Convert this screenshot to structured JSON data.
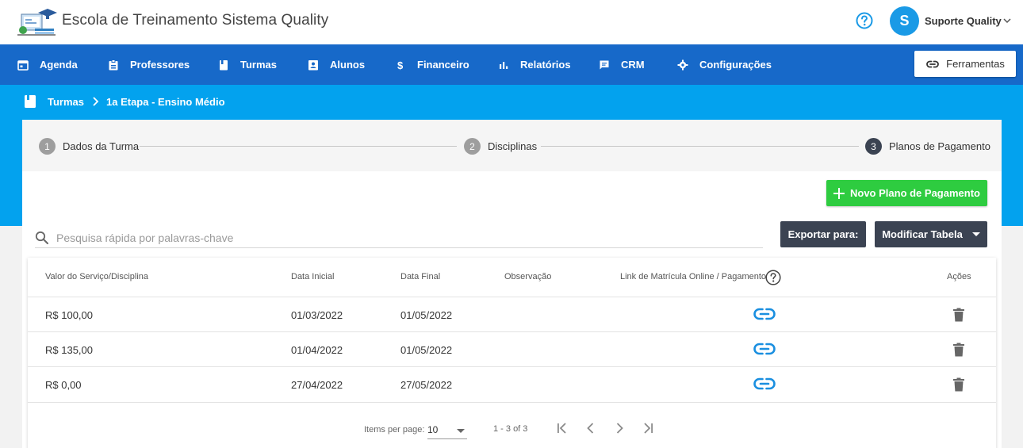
{
  "header": {
    "app_title": "Escola de Treinamento Sistema Quality",
    "user_initial": "S",
    "user_name": "Suporte Quality"
  },
  "nav": {
    "items": [
      {
        "label": "Agenda",
        "icon": "calendar-icon"
      },
      {
        "label": "Professores",
        "icon": "badge-icon"
      },
      {
        "label": "Turmas",
        "icon": "book-icon"
      },
      {
        "label": "Alunos",
        "icon": "id-card-icon"
      },
      {
        "label": "Financeiro",
        "icon": "dollar-icon"
      },
      {
        "label": "Relatórios",
        "icon": "bar-chart-icon"
      },
      {
        "label": "CRM",
        "icon": "chat-icon"
      },
      {
        "label": "Configurações",
        "icon": "gear-icon"
      }
    ],
    "tools_label": "Ferramentas"
  },
  "breadcrumb": {
    "root": "Turmas",
    "current": "1a Etapa - Ensino Médio"
  },
  "stepper": {
    "steps": [
      {
        "num": "1",
        "label": "Dados da Turma"
      },
      {
        "num": "2",
        "label": "Disciplinas"
      },
      {
        "num": "3",
        "label": "Planos de Pagamento",
        "active": true
      }
    ]
  },
  "actions": {
    "new_plan": "Novo Plano de Pagamento",
    "export": "Exportar para:",
    "modify": "Modificar Tabela"
  },
  "search": {
    "placeholder": "Pesquisa rápida por palavras-chave",
    "value": ""
  },
  "table": {
    "headers": {
      "value": "Valor do Serviço/Disciplina",
      "start": "Data Inicial",
      "end": "Data Final",
      "note": "Observação",
      "link": "Link de Matrícula Online / Pagamento",
      "actions": "Ações"
    },
    "rows": [
      {
        "value": "R$ 100,00",
        "start": "01/03/2022",
        "end": "01/05/2022",
        "note": ""
      },
      {
        "value": "R$ 135,00",
        "start": "01/04/2022",
        "end": "01/05/2022",
        "note": ""
      },
      {
        "value": "R$ 0,00",
        "start": "27/04/2022",
        "end": "27/05/2022",
        "note": ""
      }
    ]
  },
  "pagination": {
    "items_per_page_label": "Items per page:",
    "page_size": "10",
    "range": "1 - 3 of 3"
  },
  "colors": {
    "nav": "#1769c9",
    "band": "#03a2ee",
    "accent_green": "#2ecc40",
    "dark_button": "#3b4352",
    "link_icon": "#1a8fe0"
  }
}
